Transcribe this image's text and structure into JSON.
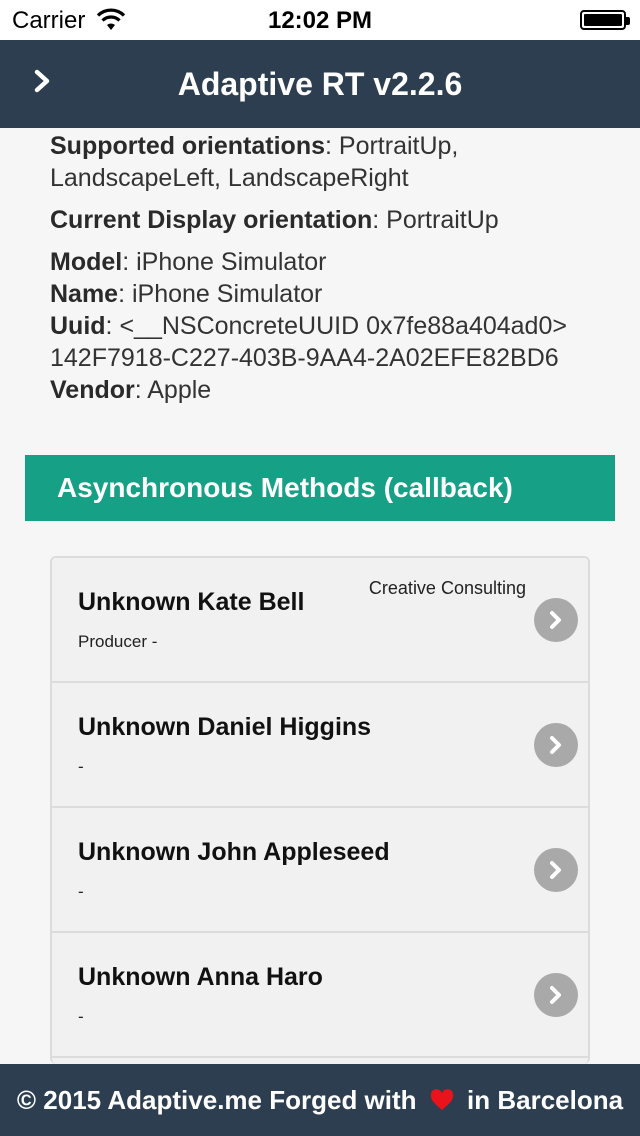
{
  "status_bar": {
    "carrier": "Carrier",
    "time": "12:02 PM"
  },
  "header": {
    "title": "Adaptive RT v2.2.6",
    "menu_icon": "chevron-right-icon"
  },
  "info": {
    "supported_label": "Supported orientations",
    "supported_value": ": PortraitUp, LandscapeLeft, LandscapeRight",
    "current_label": "Current Display orientation",
    "current_value": ": PortraitUp",
    "model_label": "Model",
    "model_value": ": iPhone Simulator",
    "name_label": "Name",
    "name_value": ": iPhone Simulator",
    "uuid_label": "Uuid",
    "uuid_value": ": <__NSConcreteUUID 0x7fe88a404ad0> 142F7918-C227-403B-9AA4-2A02EFE82BD6",
    "vendor_label": "Vendor",
    "vendor_value": ": Apple"
  },
  "section": {
    "title": "Asynchronous Methods (callback)"
  },
  "contacts": [
    {
      "name": "Unknown Kate Bell",
      "subtitle": "Producer -",
      "company": "Creative Consulting"
    },
    {
      "name": "Unknown Daniel Higgins",
      "subtitle": "-",
      "company": ""
    },
    {
      "name": "Unknown John Appleseed",
      "subtitle": "-",
      "company": ""
    },
    {
      "name": "Unknown Anna Haro",
      "subtitle": "-",
      "company": ""
    }
  ],
  "footer": {
    "text_before": "© 2015 Adaptive.me Forged with ",
    "text_after": " in Barcelona",
    "heart_color": "#e8131b"
  },
  "colors": {
    "header_bg": "#2c3e50",
    "section_bg": "#16a085",
    "chevron_bg": "#a9a9a9"
  }
}
